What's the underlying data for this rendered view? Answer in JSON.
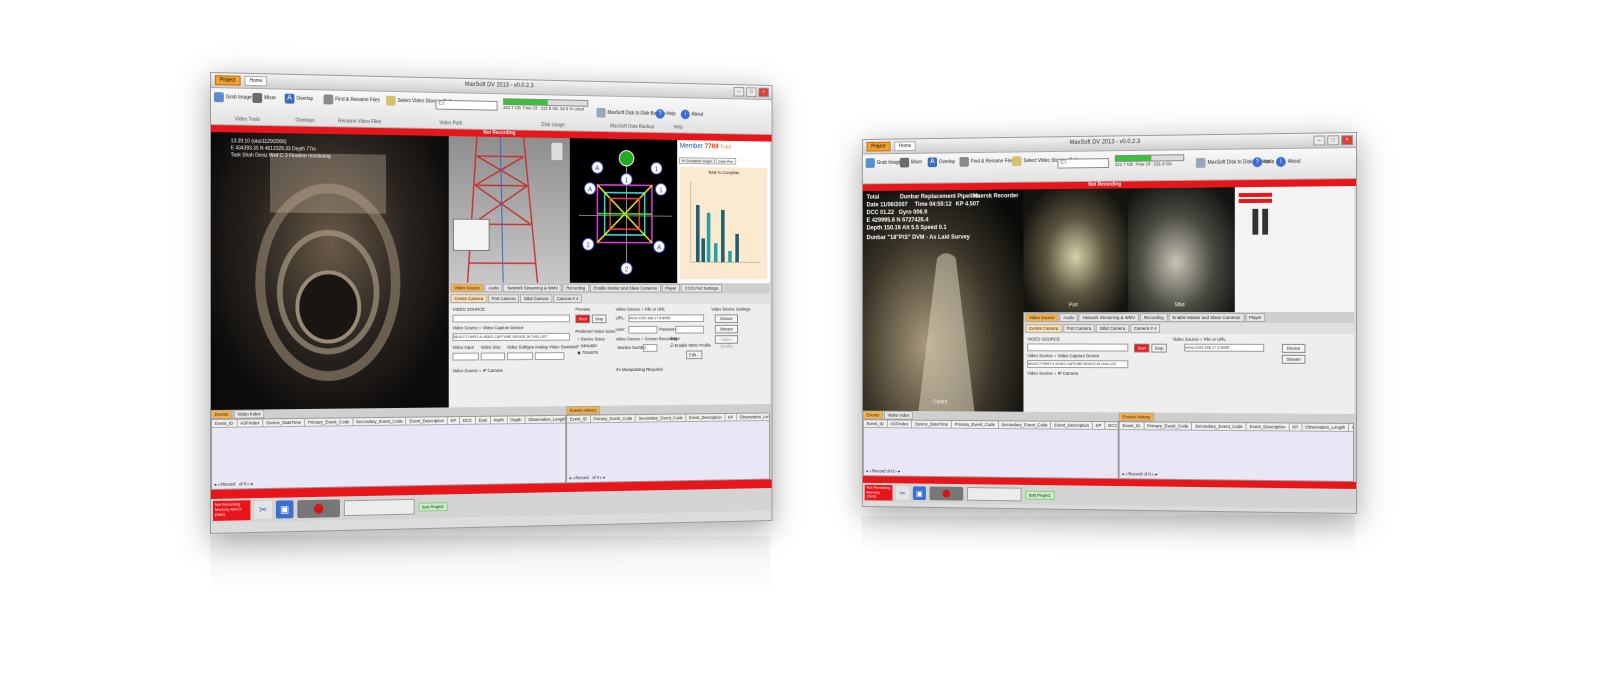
{
  "app": {
    "title": "MaxSoft DV 2013 - v0.0.2.3",
    "tab_project": "Project",
    "tab_home": "Home"
  },
  "ribbon": {
    "grab_image": "Grab Image",
    "mixer": "Mixer",
    "overlay": "Overlay",
    "find_rename": "Find & Rename Files",
    "select_video_path": "Select Video Storage Path",
    "path_value": "C:\\",
    "group_video_tools": "Video Tools",
    "group_overlays": "Overlays",
    "group_rename": "Rename Video Files",
    "group_video_path": "Video Path",
    "disk_used": "322.7 GB",
    "disk_free": "Free Of : 231.8 Gb",
    "disk_status": "52.6 % Used",
    "disk_usage_label": "Disk Usage",
    "disk_fill_pct": 52.6,
    "backup": "MaxSoft Disk to Disk Backup",
    "group_backup": "MaxSoft Data Backup",
    "help": "Help",
    "about": "About",
    "group_help": "Help"
  },
  "left": {
    "recording_banner": "Not Recording",
    "overlay_lines": [
      "13:39:10 (oka\\1129\\2006)",
      "E 434393.35  N 4512329.33  Depth 77m",
      "Task   Shah Deniz Well C-3 Flowline monitoring"
    ],
    "member_label": "Member",
    "member_number": "7789",
    "member_suffix": "Track",
    "chart_title": "Total % Complete",
    "chart_tabs": [
      "% Complete Graph",
      "Data Rec"
    ],
    "node_labels": [
      "A",
      "1",
      "2",
      "A",
      "1",
      "2",
      "A",
      "1"
    ],
    "tabs": [
      "Video Source",
      "Audio",
      "Network Streaming & WMV",
      "Recording",
      "Enable Master and Slave Cameras",
      "Player",
      "CCIS Port Settings"
    ],
    "camera_tabs": [
      "Centre Camera",
      "Port Camera",
      "Stbd Camera",
      "Camera # 4"
    ],
    "form": {
      "video_source": "VIDEO SOURCE",
      "capture_device": "Video Source = Video Capture Device",
      "select_device": "SELECT FIRST A VIDEO CAPTURE DEVICE IN THIS LIST",
      "video_input": "Video Input",
      "video_size": "Video Size",
      "video_subtype": "Video Subtype",
      "analog_std": "Analog Video Standard",
      "ip_camera": "Video Source = IP Camera",
      "preview": "Preview",
      "start": "Start",
      "stop": "Stop",
      "preferred_size": "Preferred Video Sizes",
      "size_device": "Device Sizes",
      "size_640": "640x480",
      "size_704": "704x576",
      "file_or_url": "Video Source = File or URL",
      "url_label": "URL:",
      "url_value": "mms://192.168.17.5:8005",
      "user": "User:",
      "password": "Password:",
      "screen_rec": "Video Source = Screen Recording",
      "monitor_number": "Monitor Number:",
      "monitor_value": "0",
      "wmv": "WMV",
      "enable_wmv": "Enable WMV Profile",
      "edit": "Edit...",
      "device_settings": "Video Device Settings",
      "device": "Device",
      "stream": "Stream",
      "video_quality": "Video Quality",
      "multiple": "It's Manipulating Required"
    },
    "events_tab": "Events",
    "video_index_tab": "Video Index",
    "event_cols": [
      "Event_ID",
      "ASFIndex",
      "Device_DateTime",
      "Primary_Event_Code",
      "Secondary_Event_Code",
      "Event_Description",
      "KP",
      "DCC",
      "East",
      "North",
      "Depth",
      "Observation_Length",
      "Observ"
    ],
    "history_tab": "Events History",
    "history_cols": [
      "Event_ID",
      "Primary_Event_Code",
      "Secondary_Event_Code",
      "Event_Description",
      "KP",
      "Observation_Length",
      "Observation_Width",
      "Observ"
    ],
    "record_nav": "Record",
    "record_of": "of 0",
    "status_lines": [
      "Not Recording",
      "Memory ANCO",
      "(Skin)"
    ],
    "project": "test Project"
  },
  "right": {
    "recording_banner": "Not Recording",
    "overlay": {
      "total": "Total",
      "pipeline": "Dunbar Replacement Pipeline",
      "recorder": "Maersk Recorder",
      "date_label": "Date",
      "date": "11/06/2007",
      "time_label": "Time",
      "time": "04:50:12",
      "kp_label": "KP",
      "kp": "4.507",
      "dcc_label": "DCC",
      "dcc": "01.22",
      "gyro_label": "Gyro",
      "gyro": "006.9",
      "e_label": "E",
      "e_val": "429995.6",
      "n_label": "N",
      "n_val": "6727426.4",
      "depth_label": "Depth",
      "depth": "150.19",
      "alt_label": "Alt",
      "alt": "5.5",
      "speed_label": "Speed",
      "speed": "0.1",
      "task": "Dunbar \"18\"P/S\" DVM - As Laid Survey",
      "camera_name": "Centre",
      "port_label": "Port",
      "stbd_label": "Stbd"
    },
    "project": "test Project",
    "status_lines": [
      "Not Recording",
      "Memory",
      "(Skin)"
    ]
  }
}
